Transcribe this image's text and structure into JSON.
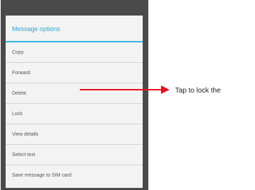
{
  "dialog": {
    "title": "Message options",
    "items": [
      {
        "label": "Copy"
      },
      {
        "label": "Forward"
      },
      {
        "label": "Delete"
      },
      {
        "label": "Lock"
      },
      {
        "label": "View details"
      },
      {
        "label": "Select text"
      },
      {
        "label": "Save message to SIM card"
      }
    ]
  },
  "annotation": {
    "text": "Tap to lock the"
  },
  "colors": {
    "accent": "#33b5e5",
    "arrow": "#e8101c"
  }
}
